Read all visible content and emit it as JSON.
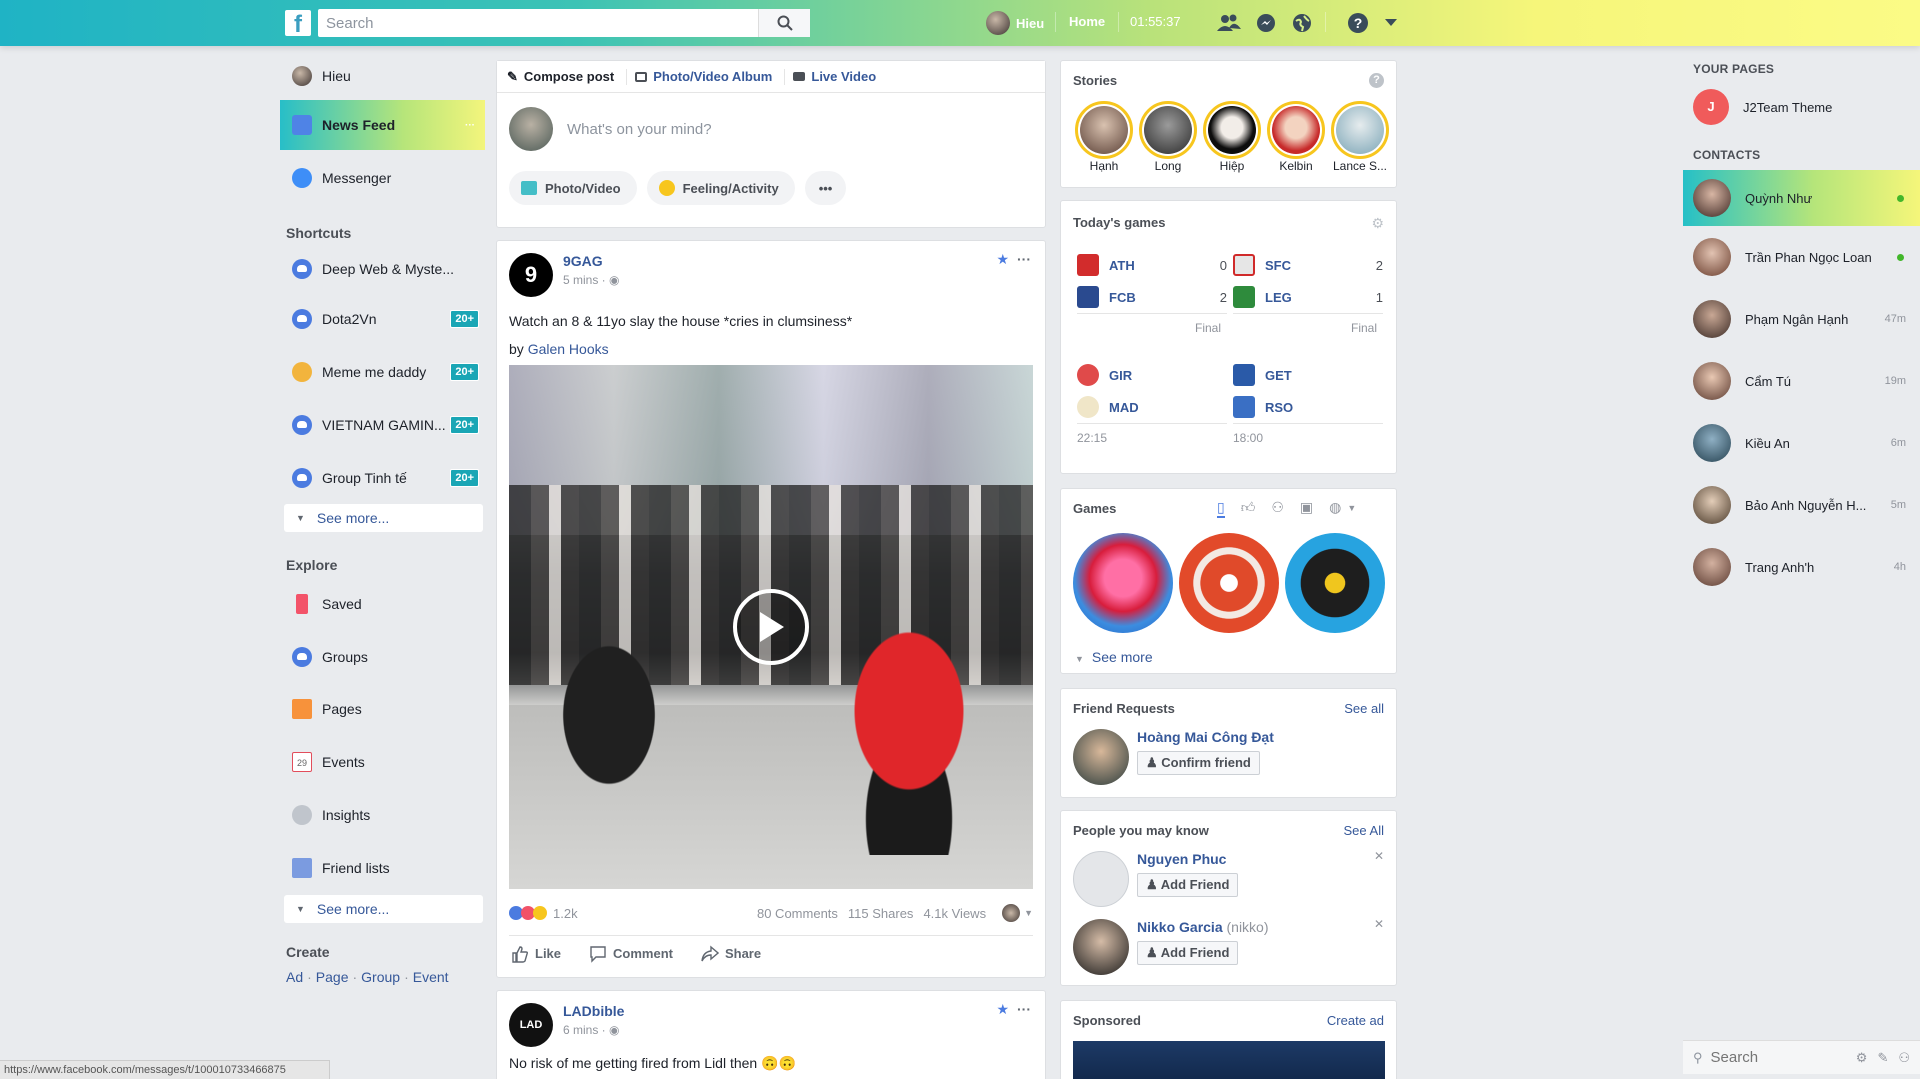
{
  "topbar": {
    "search_placeholder": "Search",
    "user_name": "Hieu",
    "home": "Home",
    "clock": "01:55:37"
  },
  "left": {
    "profile_name": "Hieu",
    "items": [
      {
        "label": "News Feed",
        "icon": "news-feed-icon"
      },
      {
        "label": "Messenger",
        "icon": "messenger-icon"
      }
    ],
    "shortcuts_title": "Shortcuts",
    "shortcuts": [
      {
        "label": "Deep Web & Myste...",
        "badge": ""
      },
      {
        "label": "Dota2Vn",
        "badge": "20+"
      },
      {
        "label": "Meme me daddy",
        "badge": "20+"
      },
      {
        "label": "VIETNAM GAMIN...",
        "badge": "20+"
      },
      {
        "label": "Group Tinh tế",
        "badge": "20+"
      }
    ],
    "see_more": "See more...",
    "explore_title": "Explore",
    "explore": [
      {
        "label": "Saved"
      },
      {
        "label": "Groups"
      },
      {
        "label": "Pages"
      },
      {
        "label": "Events"
      },
      {
        "label": "Insights"
      },
      {
        "label": "Friend lists"
      }
    ],
    "events_day": "29",
    "create_title": "Create",
    "create_links": [
      "Ad",
      "Page",
      "Group",
      "Event"
    ]
  },
  "compose": {
    "tabs": [
      "Compose post",
      "Photo/Video Album",
      "Live Video"
    ],
    "placeholder": "What's on your mind?",
    "buttons": [
      "Photo/Video",
      "Feeling/Activity",
      "•••"
    ]
  },
  "post": {
    "author": "9GAG",
    "time": "5 mins",
    "text": "Watch an 8 & 11yo slay the house *cries in clumsiness*",
    "by_prefix": "by",
    "by_name": "Galen Hooks",
    "reactions": "1.2k",
    "comments": "80 Comments",
    "shares": "115 Shares",
    "views": "4.1k Views",
    "actions": [
      "Like",
      "Comment",
      "Share"
    ]
  },
  "post2": {
    "author": "LADbible",
    "time": "6 mins",
    "text": "No risk of me getting fired from Lidl then 🙃🙃"
  },
  "stories": {
    "title": "Stories",
    "people": [
      "Hạnh",
      "Long",
      "Hiệp",
      "Kelbin",
      "Lance S..."
    ]
  },
  "games_today": {
    "title": "Today's games",
    "matches": [
      {
        "home": "ATH",
        "home_score": "0",
        "away": "FCB",
        "away_score": "2",
        "status": "Final"
      },
      {
        "home": "SFC",
        "home_score": "2",
        "away": "LEG",
        "away_score": "1",
        "status": "Final"
      },
      {
        "home": "GIR",
        "home_score": "",
        "away": "MAD",
        "away_score": "",
        "status": "22:15"
      },
      {
        "home": "GET",
        "home_score": "",
        "away": "RSO",
        "away_score": "",
        "status": "18:00"
      }
    ]
  },
  "games": {
    "title": "Games",
    "see_more": "See more"
  },
  "friend_requests": {
    "title": "Friend Requests",
    "see_all": "See all",
    "name": "Hoàng Mai Công Đạt",
    "confirm": "Confirm friend"
  },
  "people": {
    "title": "People you may know",
    "see_all": "See All",
    "items": [
      {
        "name": "Nguyen Phuc",
        "alt": "",
        "button": "Add Friend"
      },
      {
        "name": "Nikko Garcia",
        "alt": "(nikko)",
        "button": "Add Friend"
      }
    ]
  },
  "sponsored": {
    "title": "Sponsored",
    "create_ad": "Create ad"
  },
  "chat": {
    "pages_title": "YOUR PAGES",
    "page": {
      "initial": "J",
      "name": "J2Team Theme"
    },
    "contacts_title": "CONTACTS",
    "contacts": [
      {
        "name": "Quỳnh Như",
        "status": "online"
      },
      {
        "name": "Trần Phan Ngọc Loan",
        "status": "online"
      },
      {
        "name": "Phạm Ngân Hạnh",
        "status": "47m"
      },
      {
        "name": "Cẩm Tú",
        "status": "19m"
      },
      {
        "name": "Kiều An",
        "status": "6m"
      },
      {
        "name": "Bảo Anh Nguyễn H...",
        "status": "5m"
      },
      {
        "name": "Trang Anh'h",
        "status": "4h"
      }
    ],
    "search_placeholder": "Search"
  },
  "statusbar": {
    "url": "https://www.facebook.com/messages/t/100010733466875"
  }
}
